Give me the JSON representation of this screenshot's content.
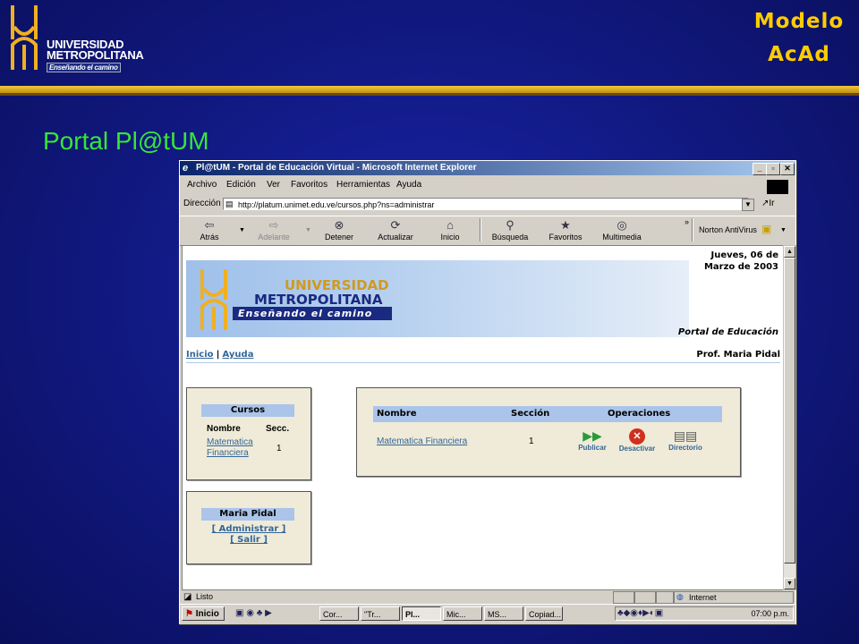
{
  "slide": {
    "logo": {
      "line1": "UNIVERSIDAD",
      "line2": "METROPOLITANA",
      "line3": "Enseñando el camino"
    },
    "corner": {
      "line1": "Modelo",
      "line2": "AcAd"
    },
    "title": "Portal Pl@tUM"
  },
  "browser": {
    "window_title": "Pl@tUM - Portal de Educación Virtual - Microsoft Internet Explorer",
    "menu": [
      "Archivo",
      "Edición",
      "Ver",
      "Favoritos",
      "Herramientas",
      "Ayuda"
    ],
    "address_label": "Dirección",
    "address": "http://platum.unimet.edu.ve/cursos.php?ns=administrar",
    "go": "Ir",
    "toolbar": [
      {
        "label": "Atrás",
        "icon": "back-arrow-icon"
      },
      {
        "label": "Adelante",
        "icon": "forward-arrow-icon"
      },
      {
        "label": "Detener",
        "icon": "stop-icon"
      },
      {
        "label": "Actualizar",
        "icon": "refresh-icon"
      },
      {
        "label": "Inicio",
        "icon": "home-icon"
      },
      {
        "label": "Búsqueda",
        "icon": "search-icon"
      },
      {
        "label": "Favoritos",
        "icon": "favorites-icon"
      },
      {
        "label": "Multimedia",
        "icon": "media-icon"
      }
    ],
    "norton": "Norton AntiVirus",
    "status": "Listo",
    "zone": "Internet"
  },
  "page": {
    "date": "Jueves, 06 de Marzo de 2003",
    "banner": {
      "line1": "UNIVERSIDAD",
      "line2": "METROPOLITANA",
      "line3": "Enseñando el camino"
    },
    "portal": "Portal de Educación",
    "nav": {
      "home": "Inicio",
      "separator": "|",
      "help": "Ayuda"
    },
    "professor": "Prof. Maria Pidal",
    "courses_box": {
      "header": "Cursos",
      "col_name": "Nombre",
      "col_sec": "Secc.",
      "rows": [
        {
          "name": "Matematica Financiera",
          "section": "1"
        }
      ]
    },
    "user_box": {
      "header": "Maria Pidal",
      "admin": "[ Administrar ]",
      "logout": "[ Salir ]"
    },
    "table": {
      "headers": [
        "Nombre",
        "Sección",
        "Operaciones"
      ],
      "rows": [
        {
          "name": "Matematica Financiera",
          "section": "1",
          "ops": [
            "Publicar",
            "Desactivar",
            "Directorio"
          ]
        }
      ]
    }
  },
  "taskbar": {
    "start": "Inicio",
    "tasks": [
      "Cor...",
      "\"Tr...",
      "Pl...",
      "Mic...",
      "MS...",
      "Copiad..."
    ],
    "clock": "07:00 p.m."
  }
}
